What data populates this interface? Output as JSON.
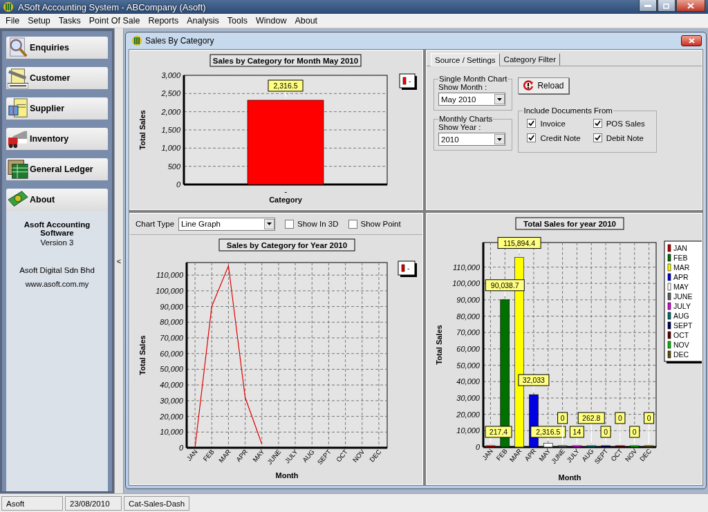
{
  "window": {
    "title": "ASoft Accounting System - ABCompany (Asoft)"
  },
  "menu": [
    "File",
    "Setup",
    "Tasks",
    "Point Of Sale",
    "Reports",
    "Analysis",
    "Tools",
    "Window",
    "About"
  ],
  "sidebar": {
    "items": [
      {
        "label": "Enquiries",
        "kind": "search",
        "expanded": false
      },
      {
        "label": "Customer",
        "kind": "received",
        "expanded": false
      },
      {
        "label": "Supplier",
        "kind": "invoice",
        "expanded": false
      },
      {
        "label": "Inventory",
        "kind": "truck",
        "expanded": false
      },
      {
        "label": "General Ledger",
        "kind": "ledger",
        "expanded": false
      },
      {
        "label": "About",
        "kind": "money",
        "expanded": true
      }
    ],
    "panel": [
      {
        "text": "Asoft Accounting Software",
        "kind": "heading"
      },
      {
        "text": "Version 3",
        "kind": "line"
      },
      {
        "text": "Asoft Digital Sdn Bhd",
        "kind": "company"
      },
      {
        "text": "www.asoft.com.my",
        "kind": "link"
      }
    ]
  },
  "splitter": {
    "label": "<"
  },
  "child_window": {
    "title": "Sales By Category"
  },
  "month_chart": {
    "chart_data": {
      "type": "bar",
      "title": "Sales by Category for Month May 2010",
      "xlabel": "Category",
      "ylabel": "Total Sales",
      "categories": [
        "-"
      ],
      "series": [
        {
          "name": "-",
          "color": "#ff0000",
          "values": [
            2316.5
          ]
        }
      ],
      "ylim": [
        0,
        3000
      ],
      "yticks": [
        0,
        500,
        {
          "value": 1000,
          "label": "1,000"
        },
        {
          "value": 1500,
          "label": "1,500"
        },
        {
          "value": 2000,
          "label": "2,000"
        },
        {
          "value": 2500,
          "label": "2,500"
        },
        {
          "value": 3000,
          "label": "3,000"
        }
      ],
      "value_labels": [
        "2,316.5"
      ],
      "grid": true,
      "legend": true
    }
  },
  "settings": {
    "tabs": [
      {
        "label": "Source / Settings",
        "selected": true
      },
      {
        "label": "Category Filter",
        "selected": false
      }
    ],
    "single_month": {
      "title": "Single Month Chart",
      "label": "Show Month :",
      "value": "May 2010"
    },
    "monthly": {
      "title": "Monthly Charts",
      "label": "Show Year :",
      "value": "2010"
    },
    "reload": "Reload",
    "documents": {
      "title": "Include Documents From",
      "items": [
        {
          "label": "Invoice",
          "checked": true
        },
        {
          "label": "POS Sales",
          "checked": true
        },
        {
          "label": "Credit Note",
          "checked": true
        },
        {
          "label": "Debit Note",
          "checked": true
        }
      ]
    }
  },
  "year_chart": {
    "toolbar": {
      "label": "Chart Type",
      "value": "Line Graph",
      "options": [
        {
          "label": "Show In 3D",
          "checked": false
        },
        {
          "label": "Show Point",
          "checked": false
        }
      ]
    },
    "chart_data": {
      "type": "line",
      "title": "Sales by Category for Year 2010",
      "xlabel": "Month",
      "ylabel": "Total Sales",
      "categories": [
        "JAN",
        "FEB",
        "MAR",
        "APR",
        "MAY",
        "JUNE",
        "JULY",
        "AUG",
        "SEPT",
        "OCT",
        "NOV",
        "DEC"
      ],
      "series": [
        {
          "name": "-",
          "color": "#e00000",
          "values": [
            217.4,
            90038.7,
            115894.4,
            32033,
            2316.5,
            null,
            null,
            null,
            null,
            null,
            null,
            null
          ]
        }
      ],
      "grid": true,
      "legend": true,
      "ylim": [
        0,
        118000
      ],
      "yticks": [
        0,
        {
          "value": 10000,
          "label": "10,000"
        },
        {
          "value": 20000,
          "label": "20,000"
        },
        {
          "value": 30000,
          "label": "30,000"
        },
        {
          "value": 40000,
          "label": "40,000"
        },
        {
          "value": 50000,
          "label": "50,000"
        },
        {
          "value": 60000,
          "label": "60,000"
        },
        {
          "value": 70000,
          "label": "70,000"
        },
        {
          "value": 80000,
          "label": "80,000"
        },
        {
          "value": 90000,
          "label": "90,000"
        },
        {
          "value": 100000,
          "label": "100,000"
        },
        {
          "value": 110000,
          "label": "110,000"
        }
      ]
    }
  },
  "total_chart": {
    "chart_data": {
      "type": "bar",
      "title": "Total Sales for year 2010",
      "xlabel": "Month",
      "ylabel": "Total Sales",
      "categories": [
        "JAN",
        "FEB",
        "MAR",
        "APR",
        "MAY",
        "JUNE",
        "JULY",
        "AUG",
        "SEPT",
        "OCT",
        "NOV",
        "DEC"
      ],
      "series": [
        {
          "name": "JAN",
          "color": "#c00000",
          "values": [
            217.4,
            null,
            null,
            null,
            null,
            null,
            null,
            null,
            null,
            null,
            null,
            null
          ]
        },
        {
          "name": "FEB",
          "color": "#007000",
          "values": [
            null,
            90038.7,
            null,
            null,
            null,
            null,
            null,
            null,
            null,
            null,
            null,
            null
          ]
        },
        {
          "name": "MAR",
          "color": "#ffff00",
          "values": [
            null,
            null,
            115894.4,
            null,
            null,
            null,
            null,
            null,
            null,
            null,
            null,
            null
          ]
        },
        {
          "name": "APR",
          "color": "#0000e0",
          "values": [
            null,
            null,
            null,
            32033,
            null,
            null,
            null,
            null,
            null,
            null,
            null,
            null
          ]
        },
        {
          "name": "MAY",
          "color": "#ffffff",
          "values": [
            null,
            null,
            null,
            null,
            2316.5,
            null,
            null,
            null,
            null,
            null,
            null,
            null
          ]
        },
        {
          "name": "JUNE",
          "color": "#606060",
          "values": [
            null,
            null,
            null,
            null,
            null,
            0,
            null,
            null,
            null,
            null,
            null,
            null
          ]
        },
        {
          "name": "JULY",
          "color": "#e000e0",
          "values": [
            null,
            null,
            null,
            null,
            null,
            null,
            14,
            null,
            null,
            null,
            null,
            null
          ]
        },
        {
          "name": "AUG",
          "color": "#007070",
          "values": [
            null,
            null,
            null,
            null,
            null,
            null,
            null,
            262.8,
            null,
            null,
            null,
            null
          ]
        },
        {
          "name": "SEPT",
          "color": "#000060",
          "values": [
            null,
            null,
            null,
            null,
            null,
            null,
            null,
            null,
            0,
            null,
            null,
            null
          ]
        },
        {
          "name": "OCT",
          "color": "#600000",
          "values": [
            null,
            null,
            null,
            null,
            null,
            null,
            null,
            null,
            null,
            0,
            null,
            null
          ]
        },
        {
          "name": "NOV",
          "color": "#00c000",
          "values": [
            null,
            null,
            null,
            null,
            null,
            null,
            null,
            null,
            null,
            null,
            0,
            null
          ]
        },
        {
          "name": "DEC",
          "color": "#605000",
          "values": [
            null,
            null,
            null,
            null,
            null,
            null,
            null,
            null,
            null,
            null,
            null,
            0
          ]
        }
      ],
      "ylim": [
        0,
        125000
      ],
      "yticks": [
        0,
        {
          "value": 10000,
          "label": "10,000"
        },
        {
          "value": 20000,
          "label": "20,000"
        },
        {
          "value": 30000,
          "label": "30,000"
        },
        {
          "value": 40000,
          "label": "40,000"
        },
        {
          "value": 50000,
          "label": "50,000"
        },
        {
          "value": 60000,
          "label": "60,000"
        },
        {
          "value": 70000,
          "label": "70,000"
        },
        {
          "value": 80000,
          "label": "80,000"
        },
        {
          "value": 90000,
          "label": "90,000"
        },
        {
          "value": 100000,
          "label": "100,000"
        },
        {
          "value": 110000,
          "label": "110,000"
        }
      ],
      "value_labels": [
        "217.4",
        "90,038.7",
        "115,894.4",
        "32,033",
        "2,316.5",
        "0",
        "14",
        "262.8",
        "0",
        "0",
        "0",
        "0"
      ],
      "grid": true,
      "legend": true
    }
  },
  "status_bar": [
    "Asoft",
    "23/08/2010",
    "Cat-Sales-Dash"
  ]
}
